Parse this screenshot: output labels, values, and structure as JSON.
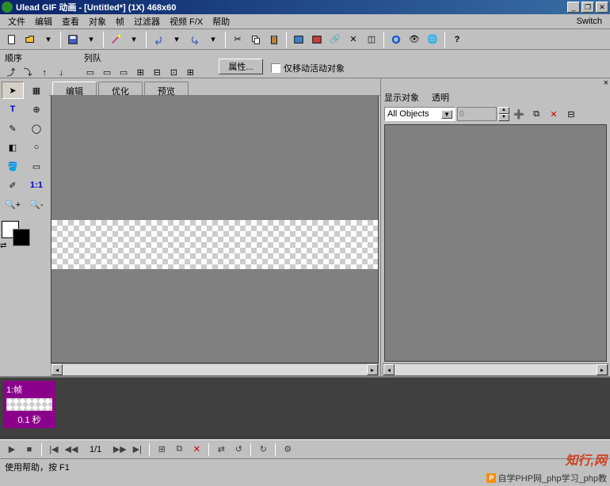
{
  "title": "Ulead GIF 动画 - [Untitled*]  (1X)  468x60",
  "menu": {
    "file": "文件",
    "edit": "编辑",
    "view": "查看",
    "object": "对象",
    "frame": "帧",
    "filter": "过滤器",
    "videofx": "视频 F/X",
    "help": "帮助",
    "switch": "Switch"
  },
  "toolbar2": {
    "order": "顺序",
    "queue": "列队",
    "properties": "属性...",
    "moveonly": "仅移动活动对象"
  },
  "tabs": {
    "edit": "编辑",
    "optimize": "优化",
    "preview": "预览"
  },
  "rightpanel": {
    "showobj": "显示对象",
    "transparent": "透明",
    "combo": "All Objects",
    "spin": "0"
  },
  "frame": {
    "head": "1:帧",
    "foot": "0.1 秒"
  },
  "playback": {
    "count": "1/1"
  },
  "status": "使用帮助，按 F1",
  "watermark": "知行,网",
  "footer": "自学PHP网_php学习_php教"
}
